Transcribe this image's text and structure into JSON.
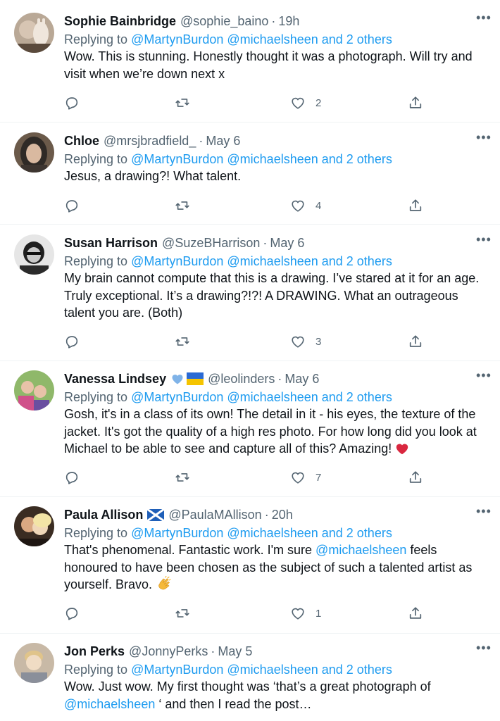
{
  "replies": [
    {
      "name": "Sophie Bainbridge",
      "handle": "@sophie_baino",
      "time": "19h",
      "replying_prefix": "Replying to",
      "mentions": "@MartynBurdon @michaelsheen and 2 others",
      "text": "Wow. This is stunning. Honestly thought it was a photograph. Will try and visit when we’re down next x",
      "likes": "2",
      "avatar_colors": [
        "#c9b8a8",
        "#5a4a3c"
      ]
    },
    {
      "name": "Chloe",
      "handle": "@mrsjbradfield_",
      "time": "May 6",
      "replying_prefix": "Replying to",
      "mentions": "@MartynBurdon @michaelsheen and 2 others",
      "text": "Jesus, a drawing?! What talent.",
      "likes": "4",
      "avatar_colors": [
        "#2f2a26",
        "#d9b9a0"
      ]
    },
    {
      "name": "Susan Harrison",
      "handle": "@SuzeBHarrison",
      "time": "May 6",
      "replying_prefix": "Replying to",
      "mentions": "@MartynBurdon @michaelsheen and 2 others",
      "text": "My brain cannot compute that this is a drawing. I’ve stared at it for an age. Truly exceptional. It’s a drawing?!?! A DRAWING. What an outrageous talent you are. (Both)",
      "likes": "3",
      "avatar_colors": [
        "#e8e8e8",
        "#222222"
      ]
    },
    {
      "name": "Vanessa Lindsey",
      "name_extra": [
        "blue-heart-icon",
        "ukraine-flag-icon"
      ],
      "handle": "@leolinders",
      "time": "May 6",
      "replying_prefix": "Replying to",
      "mentions": "@MartynBurdon @michaelsheen and 2 others",
      "text": "Gosh, it's in a class of its own! The detail in it - his eyes, the texture of the jacket. It's got the quality of a high res photo. For how long did you look at Michael to be able to see and capture all of this? Amazing!",
      "text_emoji": "red-heart-icon",
      "likes": "7",
      "avatar_colors": [
        "#8fb86a",
        "#d0508a"
      ]
    },
    {
      "name": "Paula Allison",
      "name_extra": [
        "scotland-flag-icon"
      ],
      "handle": "@PaulaMAllison",
      "time": "20h",
      "replying_prefix": "Replying to",
      "mentions": "@MartynBurdon @michaelsheen and 2 others",
      "text_before": "That's phenomenal. Fantastic work. I'm sure",
      "text_mention": "@michaelsheen",
      "text_after": "feels honoured to have been chosen as the subject of such a talented artist as yourself. Bravo.",
      "text_emoji": "clapping-hands-icon",
      "likes": "1",
      "avatar_colors": [
        "#3a2c22",
        "#e8c9a0"
      ]
    },
    {
      "name": "Jon Perks",
      "handle": "@JonnyPerks",
      "time": "May 5",
      "replying_prefix": "Replying to",
      "mentions": "@MartynBurdon @michaelsheen and 2 others",
      "text_before": "Wow. Just wow. My first thought was ‘that’s a great photograph of",
      "text_mention": "@michaelsheen",
      "text_after": "‘ and then I read the post…",
      "avatar_colors": [
        "#c8b9a6",
        "#f0dcc4"
      ]
    }
  ],
  "colors": {
    "accent": "#1d9bf0",
    "secondary_text": "#536471",
    "divider": "#eff3f4"
  },
  "icons": {
    "reply": "reply-icon",
    "retweet": "retweet-icon",
    "like": "heart-icon",
    "share": "share-icon",
    "more": "more-icon"
  }
}
